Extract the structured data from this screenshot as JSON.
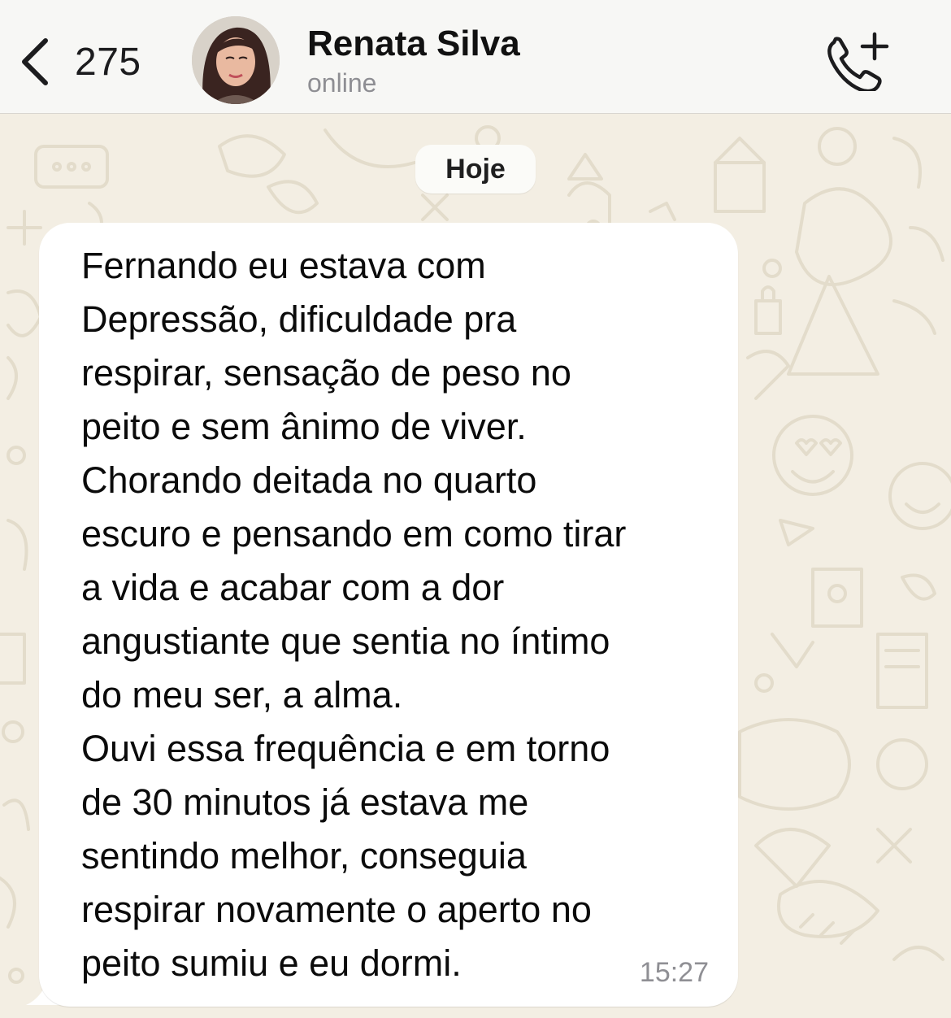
{
  "header": {
    "back_count": "275",
    "contact_name": "Renata Silva",
    "contact_status": "online",
    "back_icon": "chevron-left-icon",
    "call_icon": "phone-plus-icon"
  },
  "chat": {
    "date_label": "Hoje",
    "messages": [
      {
        "text": "Fernando eu estava com\nDepressão, dificuldade pra\nrespirar, sensação de peso no\npeito e sem ânimo de viver.\nChorando deitada no quarto\nescuro e pensando em como tirar\na vida e acabar com a dor\nangustiante que sentia no íntimo\ndo meu ser, a alma.\nOuvi essa frequência e em torno\nde 30 minutos já estava me\nsentindo melhor, conseguia\nrespirar novamente o aperto no\npeito sumiu e eu dormi.",
        "time": "15:27"
      }
    ]
  },
  "colors": {
    "background": "#f3eee3",
    "header": "#f7f7f5",
    "bubble": "#ffffff",
    "doodle": "#e6dfcf"
  }
}
